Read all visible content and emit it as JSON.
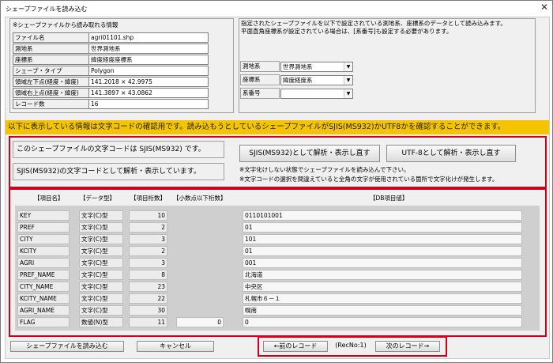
{
  "window": {
    "title": "シェープファイルを読み込む",
    "close": "✕"
  },
  "info": {
    "heading": "※シェープファイルから読み取れる情報",
    "rows": [
      {
        "label": "ファイル名",
        "value": "agri01101.shp"
      },
      {
        "label": "測地系",
        "value": "世界測地系"
      },
      {
        "label": "座標系",
        "value": "緯度経度座標系"
      },
      {
        "label": "シェープ・タイプ",
        "value": "Polygon"
      },
      {
        "label": "領域左下点(経度・緯度)",
        "value": "141.2018 × 42.9975"
      },
      {
        "label": "領域右上点(経度・緯度)",
        "value": "141.3897 × 43.0862"
      },
      {
        "label": "レコード数",
        "value": "16"
      }
    ]
  },
  "settings": {
    "desc1": "指定されたシェープファイルを以下で設定されている測地系、座標系のデータとして読み込みます。",
    "desc2": "平面直角座標系が設定されている場合は、[系番号]も設定する必要があります。",
    "fields": [
      {
        "label": "測地系",
        "value": "世界測地系"
      },
      {
        "label": "座標系",
        "value": "緯度経度系"
      },
      {
        "label": "系番号",
        "value": ""
      }
    ]
  },
  "banner": "以下に表示している情報は文字コードの確認用です。読み込もうとしているシェープファイルがSJIS(MS932)かUTF8かを確認することができます。",
  "encoding": {
    "msg1": "このシェープファイルの文字コードは SJIS(MS932) です。",
    "msg2": "SJIS(MS932)の文字コードとして解析・表示しています。",
    "btn_sjis": "SJIS(MS932)として解析・表示し直す",
    "btn_utf8": "UTF-8として解析・表示し直す",
    "note1": "※文字化けしない状態でシェープファイルを読み込んで下さい。",
    "note2": "※文字コードの選択を間違えていると全角の文字が使用されている箇所で文字化けが発生します。"
  },
  "table": {
    "headers": [
      "【項目名】",
      "【データ型】",
      "【項目桁数】",
      "【小数点以下桁数】",
      "【DB項目値】"
    ],
    "rows": [
      {
        "name": "KEY",
        "type": "文字(C)型",
        "len": "10",
        "dec": "",
        "value": "0110101001"
      },
      {
        "name": "PREF",
        "type": "文字(C)型",
        "len": "2",
        "dec": "",
        "value": "01"
      },
      {
        "name": "CITY",
        "type": "文字(C)型",
        "len": "3",
        "dec": "",
        "value": "101"
      },
      {
        "name": "KCITY",
        "type": "文字(C)型",
        "len": "2",
        "dec": "",
        "value": "01"
      },
      {
        "name": "AGRI",
        "type": "文字(C)型",
        "len": "3",
        "dec": "",
        "value": "001"
      },
      {
        "name": "PREF_NAME",
        "type": "文字(C)型",
        "len": "8",
        "dec": "",
        "value": "北海道"
      },
      {
        "name": "CITY_NAME",
        "type": "文字(C)型",
        "len": "23",
        "dec": "",
        "value": "中央区"
      },
      {
        "name": "KCITY_NAME",
        "type": "文字(C)型",
        "len": "22",
        "dec": "",
        "value": "札幌市６－１"
      },
      {
        "name": "AGRI_NAME",
        "type": "文字(C)型",
        "len": "30",
        "dec": "",
        "value": "幌南"
      },
      {
        "name": "FLAG",
        "type": "数値(N)型",
        "len": "11",
        "dec": "0",
        "value": "0"
      }
    ]
  },
  "footer": {
    "load": "シェープファイルを読み込む",
    "cancel": "キャンセル",
    "prev": "←前のレコード",
    "recno": "(RecNo:1)",
    "next": "次のレコード→"
  }
}
